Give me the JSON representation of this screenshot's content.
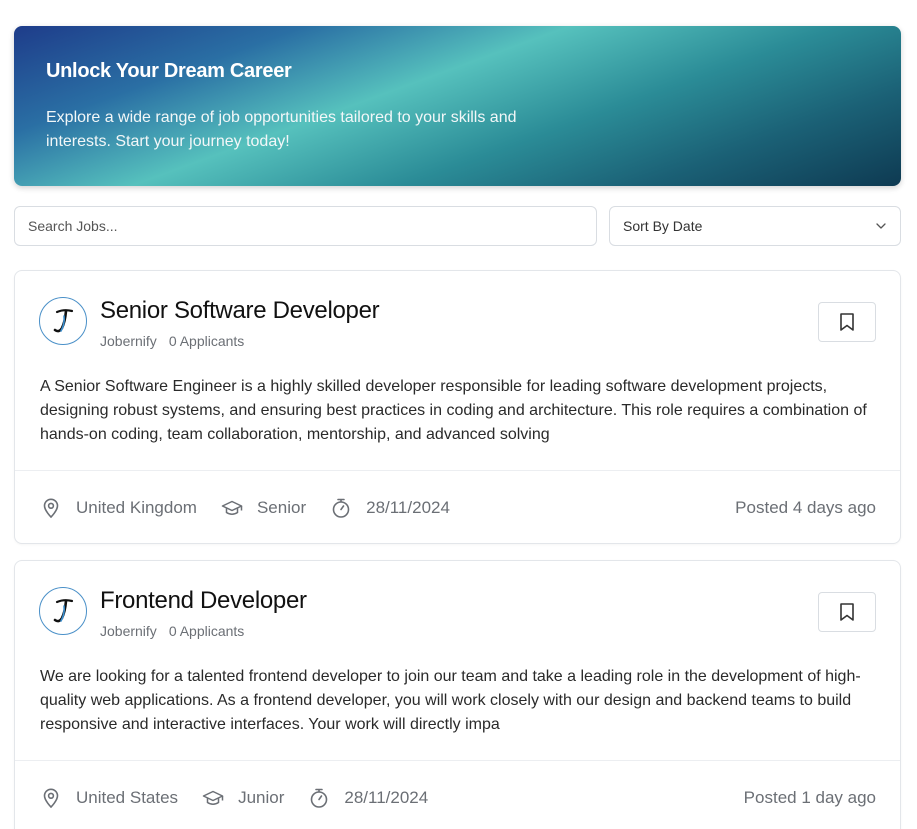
{
  "hero": {
    "title": "Unlock Your Dream Career",
    "subtitle": "Explore a wide range of job opportunities tailored to your skills and interests. Start your journey today!"
  },
  "search": {
    "placeholder": "Search Jobs..."
  },
  "sort": {
    "selected": "Sort By Date",
    "icon": "chevron-down-icon"
  },
  "jobs": [
    {
      "title": "Senior Software Developer",
      "company": "Jobernify",
      "applicants": "0 Applicants",
      "description": "A Senior Software Engineer is a highly skilled developer responsible for leading software development projects, designing robust systems, and ensuring best practices in coding and architecture. This role requires a combination of hands-on coding, team collaboration, mentorship, and advanced solving",
      "location": "United Kingdom",
      "level": "Senior",
      "deadline": "28/11/2024",
      "posted": "Posted 4 days ago"
    },
    {
      "title": "Frontend Developer",
      "company": "Jobernify",
      "applicants": "0 Applicants",
      "description": "We are looking for a talented frontend developer to join our team and take a leading role in the development of high-quality web applications. As a frontend developer, you will work closely with our design and backend teams to build responsive and interactive interfaces. Your work will directly impa",
      "location": "United States",
      "level": "Junior",
      "deadline": "28/11/2024",
      "posted": "Posted 1 day ago"
    }
  ],
  "colors": {
    "accent": "#4a90c8",
    "muted": "#6b6f75",
    "border": "#d9dde2"
  }
}
